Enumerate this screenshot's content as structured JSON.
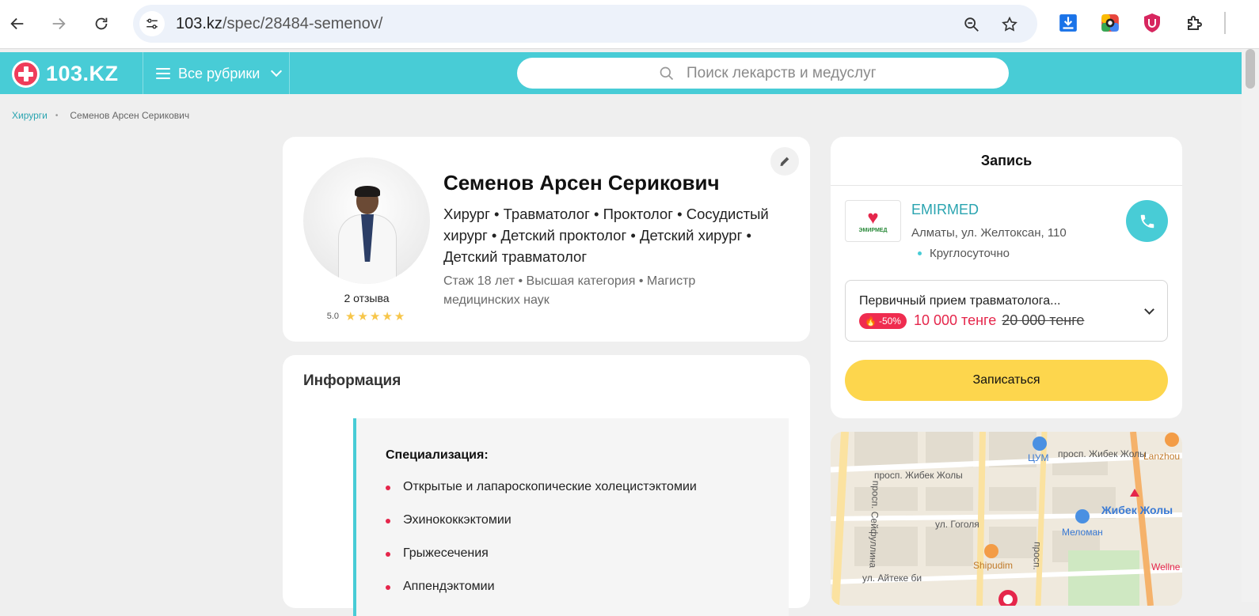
{
  "browser": {
    "url_host": "103.kz",
    "url_path": "/spec/28484-semenov/"
  },
  "header": {
    "logo_text": "103.KZ",
    "rubrics_label": "Все рубрики",
    "search_placeholder": "Поиск лекарств и медуслуг"
  },
  "breadcrumb": {
    "parent": "Хирурги",
    "separator": "•",
    "current": "Семенов Арсен Серикович"
  },
  "doctor": {
    "name": "Семенов Арсен Серикович",
    "specialties": "Хирург • Травматолог • Проктолог • Сосудистый хирург • Детский проктолог • Детский хирург • Детский травматолог",
    "experience": "Стаж 18 лет",
    "meta_separator": "•",
    "category": "Высшая категория • Магистр медицинских наук",
    "reviews": "2 отзыва",
    "rating": "5.0",
    "stars": 5
  },
  "info": {
    "title": "Информация",
    "spec_title": "Специализация:",
    "items": [
      "Открытые и лапароскопические холецистэктомии",
      "Эхинококкэктомии",
      "Грыжесечения",
      "Аппендэктомии"
    ]
  },
  "booking": {
    "title": "Запись",
    "clinic_name": "EMIRMED",
    "clinic_logo_text": "ЭМИРМЕД",
    "clinic_address": "Алматы, ул. Желтоксан, 110",
    "clinic_hours": "Круглосуточно",
    "service": "Первичный прием травматолога...",
    "discount": "-50%",
    "price_new": "10 000 тенге",
    "price_old": "20 000 тенге",
    "book_button": "Записаться"
  },
  "map": {
    "labels": {
      "zhibek1": "просп. Жибек Жолы",
      "zhibek2": "просп. Жибек Жолы",
      "tsum": "ЦУМ",
      "lanzhou": "Lanzhou",
      "seifullina": "просп. Сейфуллина",
      "zhibek_metro": "Жибек Жолы",
      "meloman": "Меломан",
      "gogolya": "ул. Гоголя",
      "shipudim": "Shipudim",
      "aiteke": "ул. Айтеке би",
      "prosp": "просп.",
      "wellne": "Wellne"
    }
  },
  "colors": {
    "brand": "#48ccd6",
    "accent_red": "#e5264b",
    "book_yellow": "#fdd64d"
  }
}
